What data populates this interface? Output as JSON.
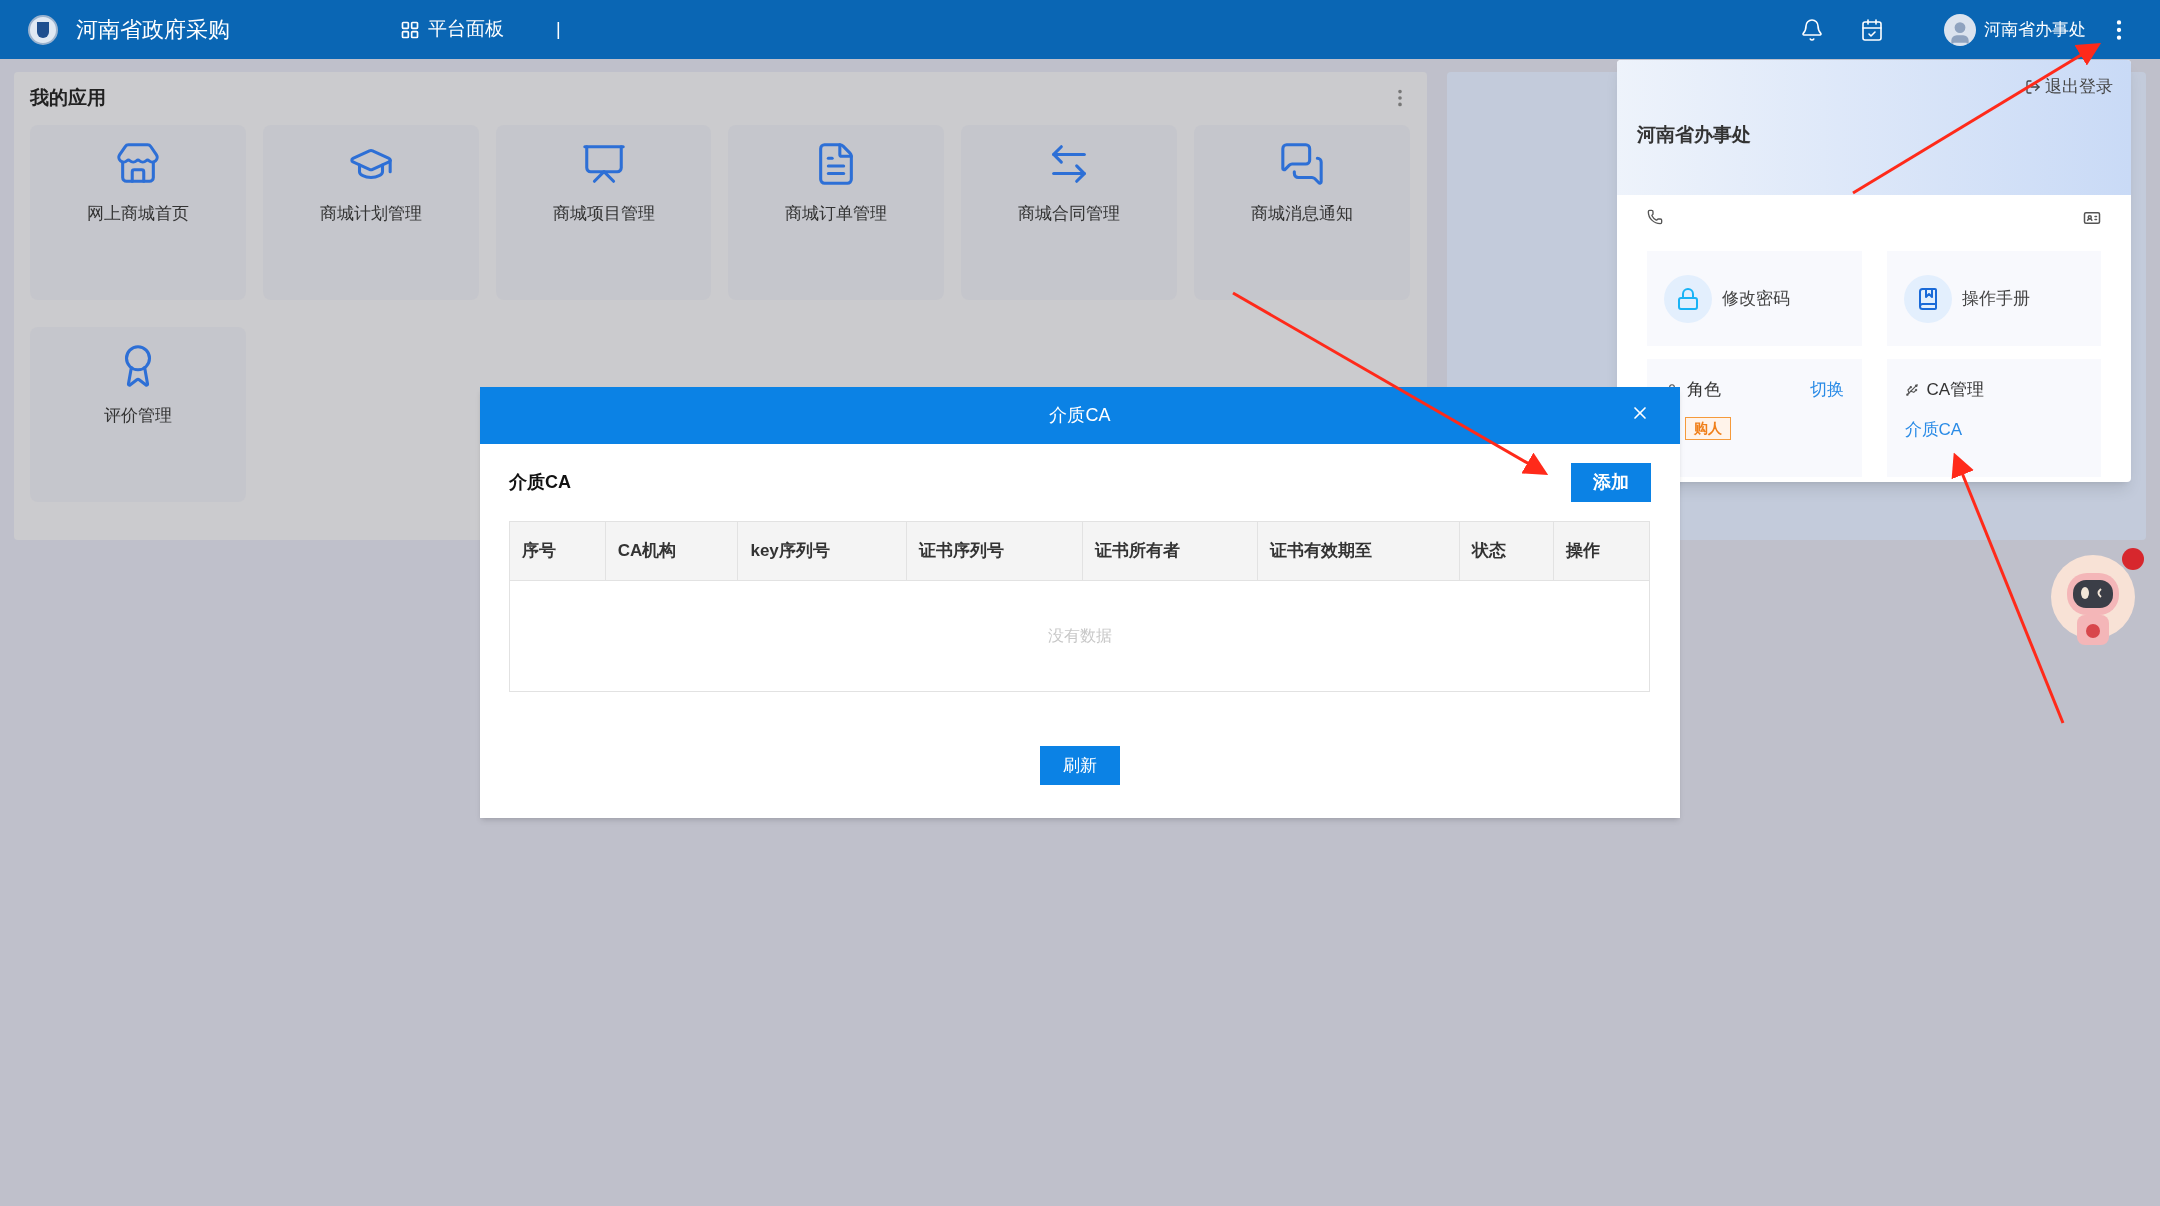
{
  "top_bar": {
    "title": "河南省政府采购",
    "nav": {
      "label": "平台面板"
    },
    "divider": "|",
    "user_name": "河南省办事处"
  },
  "apps": {
    "title": "我的应用",
    "items": [
      {
        "label": "网上商城首页"
      },
      {
        "label": "商城计划管理"
      },
      {
        "label": "商城项目管理"
      },
      {
        "label": "商城订单管理"
      },
      {
        "label": "商城合同管理"
      },
      {
        "label": "商城消息通知"
      },
      {
        "label": "评价管理"
      }
    ]
  },
  "user_popup": {
    "name": "河南省办事处",
    "logout": "退出登录",
    "tiles": [
      {
        "label": "修改密码"
      },
      {
        "label": "操作手册"
      }
    ],
    "role": {
      "label": "角色",
      "switch": "切换",
      "tag": "购人"
    },
    "ca": {
      "label": "CA管理",
      "link": "介质CA"
    }
  },
  "modal": {
    "title": "介质CA",
    "section_title": "介质CA",
    "add_button": "添加",
    "table": {
      "columns": [
        "序号",
        "CA机构",
        "key序列号",
        "证书序列号",
        "证书所有者",
        "证书有效期至",
        "状态",
        "操作"
      ],
      "empty_text": "没有数据"
    },
    "refresh_button": "刷新"
  }
}
